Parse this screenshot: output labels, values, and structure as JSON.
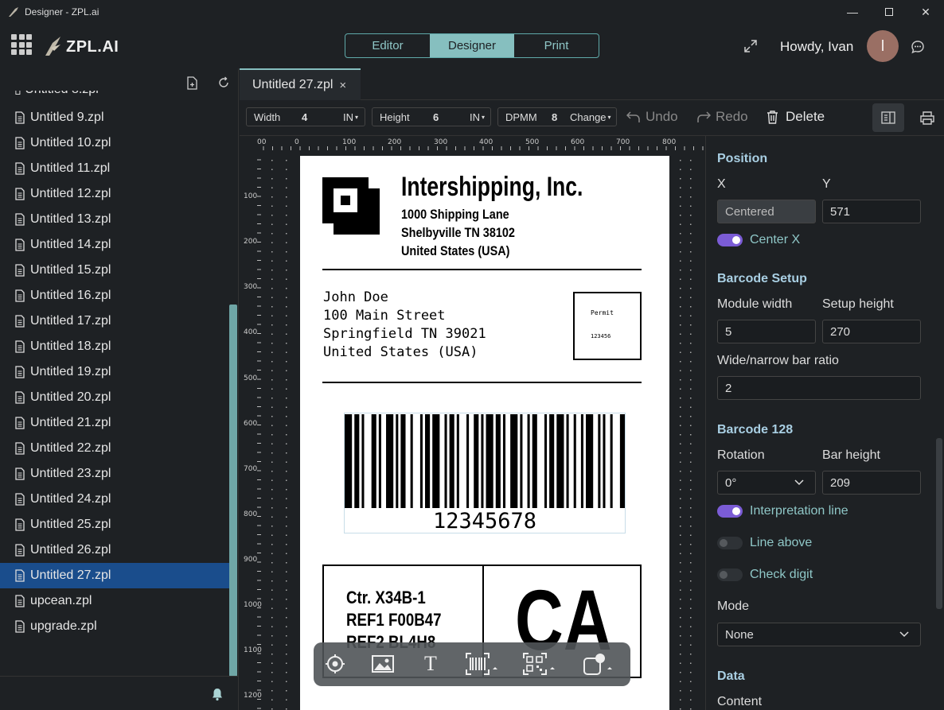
{
  "window": {
    "title": "Designer - ZPL.ai"
  },
  "header": {
    "logo_text": "ZPL.AI",
    "modes": [
      {
        "label": "Editor"
      },
      {
        "label": "Designer"
      },
      {
        "label": "Print"
      }
    ],
    "greeting": "Howdy, Ivan",
    "avatar_initial": "I"
  },
  "sidebar": {
    "files": [
      {
        "name": "Untitled 9.zpl"
      },
      {
        "name": "Untitled 10.zpl"
      },
      {
        "name": "Untitled 11.zpl"
      },
      {
        "name": "Untitled 12.zpl"
      },
      {
        "name": "Untitled 13.zpl"
      },
      {
        "name": "Untitled 14.zpl"
      },
      {
        "name": "Untitled 15.zpl"
      },
      {
        "name": "Untitled 16.zpl"
      },
      {
        "name": "Untitled 17.zpl"
      },
      {
        "name": "Untitled 18.zpl"
      },
      {
        "name": "Untitled 19.zpl"
      },
      {
        "name": "Untitled 20.zpl"
      },
      {
        "name": "Untitled 21.zpl"
      },
      {
        "name": "Untitled 22.zpl"
      },
      {
        "name": "Untitled 23.zpl"
      },
      {
        "name": "Untitled 24.zpl"
      },
      {
        "name": "Untitled 25.zpl"
      },
      {
        "name": "Untitled 26.zpl"
      },
      {
        "name": "Untitled 27.zpl"
      },
      {
        "name": "upcean.zpl"
      },
      {
        "name": "upgrade.zpl"
      }
    ],
    "selected": "Untitled 27.zpl"
  },
  "tab": {
    "label": "Untitled 27.zpl",
    "close": "×"
  },
  "toolbar": {
    "width_label": "Width",
    "width_value": "4",
    "width_unit": "IN",
    "height_label": "Height",
    "height_value": "6",
    "height_unit": "IN",
    "dpmm_label": "DPMM",
    "dpmm_value": "8",
    "dpmm_action": "Change",
    "undo": "Undo",
    "redo": "Redo",
    "delete": "Delete"
  },
  "ruler": {
    "top": [
      "00",
      "0",
      "100",
      "200",
      "300",
      "400",
      "500",
      "600",
      "700",
      "800"
    ],
    "left": [
      "100",
      "200",
      "300",
      "400",
      "500",
      "600",
      "700",
      "800",
      "900",
      "1000",
      "1100",
      "1200"
    ]
  },
  "label": {
    "company": "Intershipping, Inc.",
    "addr1": "1000 Shipping Lane",
    "addr2": "Shelbyville TN 38102",
    "addr3": "United States (USA)",
    "to1": "John Doe",
    "to2": "100 Main Street",
    "to3": "Springfield TN 39021",
    "to4": "United States (USA)",
    "permit": "Permit",
    "permit_no": "123456",
    "barcode_text": "12345678",
    "ref0": "Ctr. X34B-1",
    "ref1": "REF1 F00B47",
    "ref2": "REF2 BL4H8",
    "big": "CA"
  },
  "props": {
    "position": "Position",
    "x_label": "X",
    "y_label": "Y",
    "x_value": "Centered",
    "y_value": "571",
    "center_x": "Center X",
    "barcode_setup": "Barcode Setup",
    "module_width_label": "Module width",
    "setup_height_label": "Setup height",
    "module_width": "5",
    "setup_height": "270",
    "ratio_label": "Wide/narrow bar ratio",
    "ratio": "2",
    "barcode128": "Barcode 128",
    "rotation_label": "Rotation",
    "bar_height_label": "Bar height",
    "rotation": "0°",
    "bar_height": "209",
    "interp": "Interpretation line",
    "interp_on": true,
    "line_above": "Line above",
    "line_above_on": false,
    "check_digit": "Check digit",
    "check_digit_on": false,
    "mode_label": "Mode",
    "mode": "None",
    "data": "Data",
    "content": "Content"
  },
  "colors": {
    "accent": "#86bfbf",
    "toggle_on": "#7b5cd6",
    "selected_file": "#1a4d8c"
  }
}
